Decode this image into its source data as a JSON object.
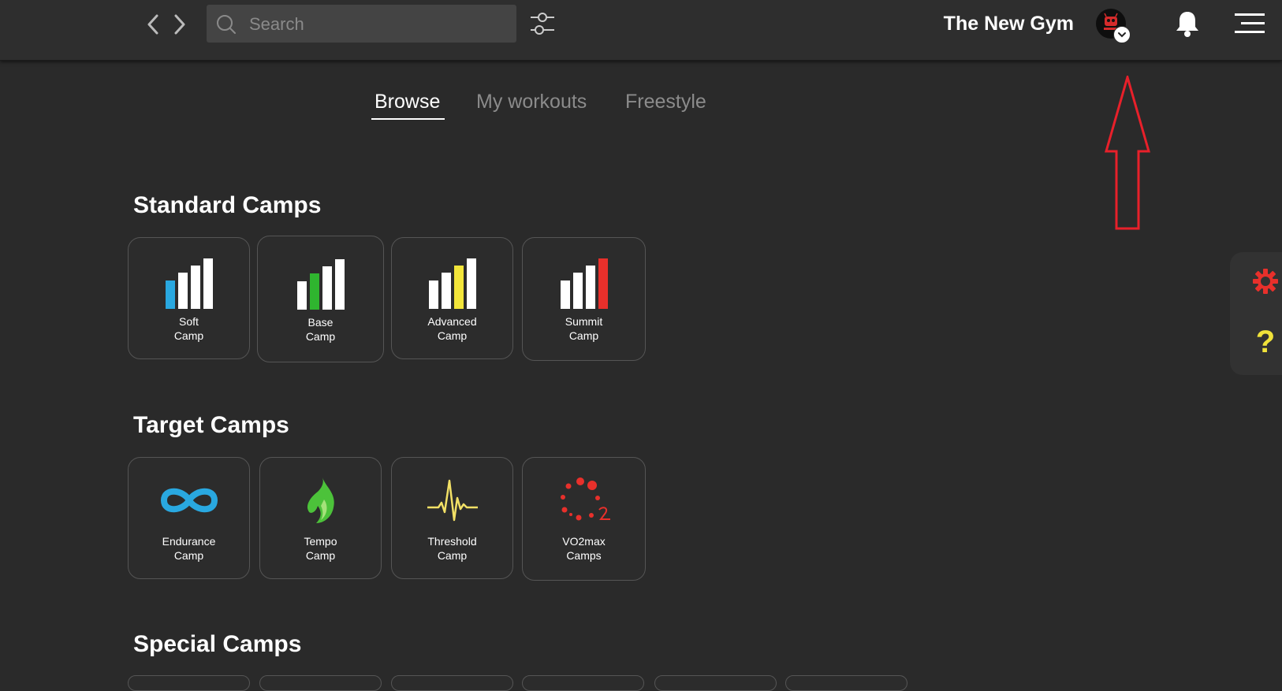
{
  "topbar": {
    "search_placeholder": "Search",
    "gym_name": "The New Gym"
  },
  "tabs": [
    {
      "label": "Browse",
      "active": true
    },
    {
      "label": "My workouts",
      "active": false
    },
    {
      "label": "Freestyle",
      "active": false
    }
  ],
  "sections": [
    {
      "title": "Standard Camps",
      "tiles": [
        {
          "line1": "Soft",
          "line2": "Camp",
          "icon": "bars-blue-icon",
          "accent": "#29a8e0"
        },
        {
          "line1": "Base",
          "line2": "Camp",
          "icon": "bars-green-icon",
          "accent": "#2fb52f"
        },
        {
          "line1": "Advanced",
          "line2": "Camp",
          "icon": "bars-yellow-icon",
          "accent": "#f2e53a"
        },
        {
          "line1": "Summit",
          "line2": "Camp",
          "icon": "bars-red-icon",
          "accent": "#e8302b"
        }
      ]
    },
    {
      "title": "Target Camps",
      "tiles": [
        {
          "line1": "Endurance",
          "line2": "Camp",
          "icon": "infinity-icon",
          "accent": "#29a8e0"
        },
        {
          "line1": "Tempo",
          "line2": "Camp",
          "icon": "flame-icon",
          "accent": "#4cc23a"
        },
        {
          "line1": "Threshold",
          "line2": "Camp",
          "icon": "heartbeat-icon",
          "accent": "#f2e066"
        },
        {
          "line1": "VO2max",
          "line2": "Camps",
          "icon": "vo2-dots-icon",
          "accent": "#e8302b"
        }
      ]
    },
    {
      "title": "Special Camps",
      "tiles": []
    }
  ],
  "side_panel": {
    "help_glyph": "?",
    "gear_color": "#e8302b",
    "help_color": "#f0e23a"
  },
  "annotation_color": "#e8202a"
}
